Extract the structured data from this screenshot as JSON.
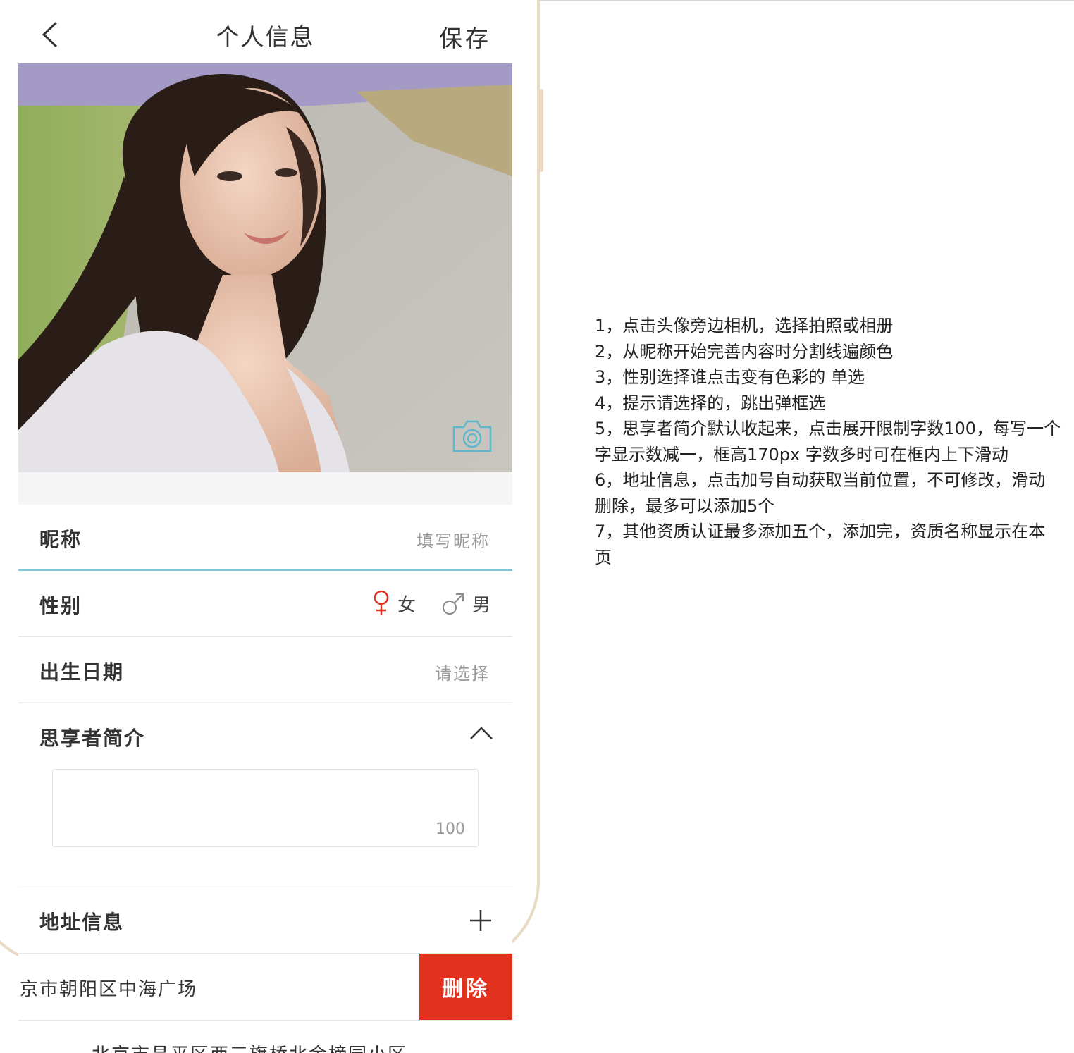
{
  "header": {
    "title": "个人信息",
    "save_label": "保存"
  },
  "icons": {
    "back": "chevron-left-icon",
    "camera": "camera-icon",
    "female": "female-symbol-icon",
    "male": "male-symbol-icon",
    "collapse": "chevron-up-icon",
    "add": "plus-icon"
  },
  "colors": {
    "accent_line": "#7fc6d6",
    "camera": "#5bb8d0",
    "female_selected": "#e2311c",
    "delete": "#e2311c"
  },
  "form": {
    "nickname": {
      "label": "昵称",
      "placeholder": "填写昵称"
    },
    "gender": {
      "label": "性别",
      "female": "女",
      "male": "男",
      "selected": "女"
    },
    "birthday": {
      "label": "出生日期",
      "placeholder": "请选择"
    },
    "intro": {
      "label": "思享者简介",
      "counter": "100",
      "expanded": true
    },
    "address": {
      "label": "地址信息",
      "items": [
        "京市朝阳区中海广场",
        "北京市昌平区西三旗桥北金榜园小区"
      ],
      "delete_label": "删除"
    }
  },
  "notes": [
    "1，点击头像旁边相机，选择拍照或相册",
    "2，从昵称开始完善内容时分割线遍颜色",
    "3，性别选择谁点击变有色彩的 单选",
    "4，提示请选择的，跳出弹框选",
    "5，思享者简介默认收起来，点击展开限制字数100，每写一个字显示数减一，框高170px 字数多时可在框内上下滑动",
    "6，地址信息，点击加号自动获取当前位置，不可修改，滑动删除，最多可以添加5个",
    "7，其他资质认证最多添加五个，添加完，资质名称显示在本页"
  ]
}
